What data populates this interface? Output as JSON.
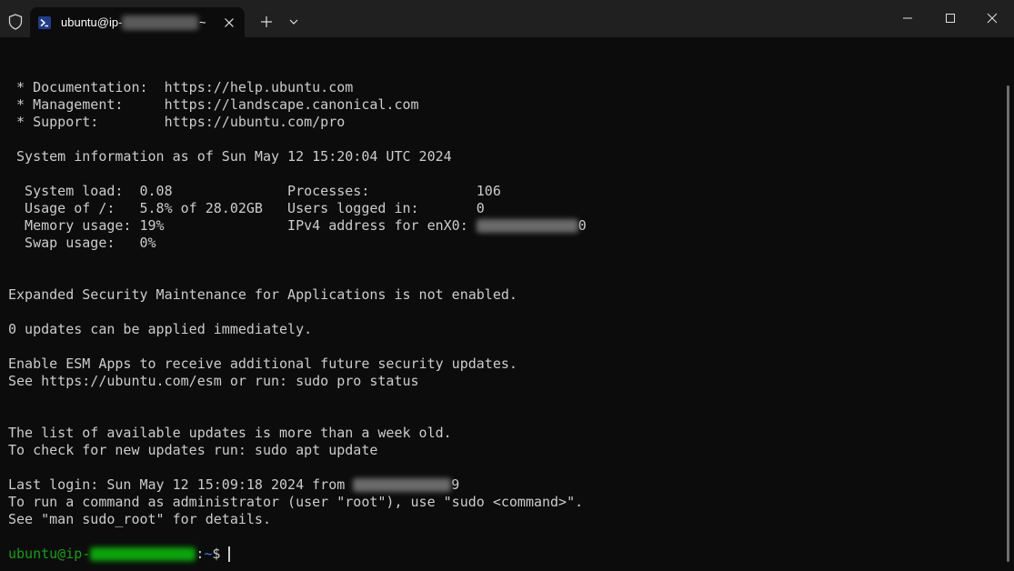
{
  "titlebar": {
    "tab_title": "ubuntu@ip-",
    "tab_title_suffix": "~"
  },
  "icons": {
    "shield": "shield-icon",
    "terminal": "powershell-icon",
    "close_tab": "close-icon",
    "new_tab": "plus-icon",
    "dropdown": "chevron-down-icon",
    "minimize": "minimize-icon",
    "maximize": "maximize-icon",
    "close_window": "close-icon"
  },
  "colors": {
    "background": "#0c0c0c",
    "titlebar": "#202020",
    "text": "#cccccc",
    "prompt_user": "#13a10e",
    "prompt_path": "#3b78ff"
  },
  "terminal": {
    "lines": [
      " * Documentation:  https://help.ubuntu.com",
      " * Management:     https://landscape.canonical.com",
      " * Support:        https://ubuntu.com/pro",
      " System information as of Sun May 12 15:20:04 UTC 2024",
      "  System load:  0.08              Processes:             106",
      "  Usage of /:   5.8% of 28.02GB   Users logged in:       0",
      "  Memory usage: 19%               IPv4 address for enX0: ",
      "  Swap usage:   0%",
      "Expanded Security Maintenance for Applications is not enabled.",
      "0 updates can be applied immediately.",
      "Enable ESM Apps to receive additional future security updates.",
      "See https://ubuntu.com/esm or run: sudo pro status",
      "The list of available updates is more than a week old.",
      "To check for new updates run: sudo apt update",
      "Last login: Sun May 12 15:09:18 2024 from ",
      "To run a command as administrator (user \"root\"), use \"sudo <command>\".",
      "See \"man sudo_root\" for details."
    ],
    "ipv4_tail": "0",
    "login_tail": "9",
    "prompt_user": "ubuntu@ip-",
    "prompt_path_sep": ":",
    "prompt_path": "~",
    "prompt_symbol": "$"
  }
}
